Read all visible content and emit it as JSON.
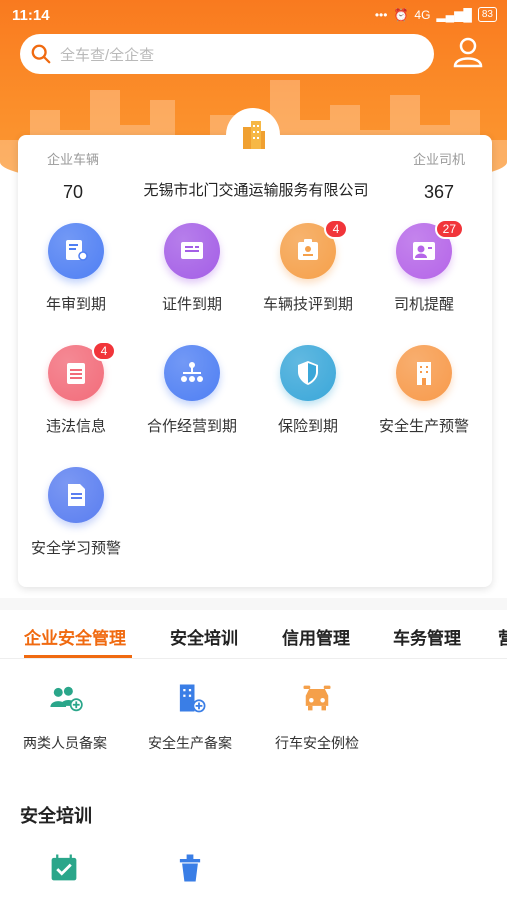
{
  "status_bar": {
    "time": "11:14",
    "network": "4G",
    "battery": "83"
  },
  "search": {
    "placeholder": "全车查/全企查"
  },
  "summary": {
    "vehicles_label": "企业车辆",
    "vehicles_count": "70",
    "drivers_label": "企业司机",
    "drivers_count": "367",
    "company_name": "无锡市北门交通运输服务有限公司"
  },
  "grid": [
    {
      "label": "年审到期",
      "icon": "document-user-icon",
      "color": "#4f7ff3",
      "badge": ""
    },
    {
      "label": "证件到期",
      "icon": "certificate-icon",
      "color": "#a45ee6",
      "badge": ""
    },
    {
      "label": "车辆技评到期",
      "icon": "id-card-icon",
      "color": "#f5a04a",
      "badge": "4"
    },
    {
      "label": "司机提醒",
      "icon": "driver-icon",
      "color": "#b565e8",
      "badge": "27"
    },
    {
      "label": "违法信息",
      "icon": "notepad-icon",
      "color": "#f26c7a",
      "badge": "4"
    },
    {
      "label": "合作经营到期",
      "icon": "org-chart-icon",
      "color": "#4f7ff3",
      "badge": ""
    },
    {
      "label": "保险到期",
      "icon": "shield-icon",
      "color": "#3aa7d9",
      "badge": ""
    },
    {
      "label": "安全生产预警",
      "icon": "building-icon",
      "color": "#f79a4b",
      "badge": ""
    },
    {
      "label": "安全学习预警",
      "icon": "file-icon",
      "color": "#5a7ef0",
      "badge": ""
    }
  ],
  "tabs": [
    {
      "label": "企业安全管理",
      "active": true
    },
    {
      "label": "安全培训",
      "active": false
    },
    {
      "label": "信用管理",
      "active": false
    },
    {
      "label": "车务管理",
      "active": false
    },
    {
      "label": "营",
      "active": false
    }
  ],
  "sub_items": [
    {
      "label": "两类人员备案",
      "icon": "users-add-icon",
      "color": "#2aa68a"
    },
    {
      "label": "安全生产备案",
      "icon": "building-add-icon",
      "color": "#3a7ee6"
    },
    {
      "label": "行车安全例检",
      "icon": "car-repair-icon",
      "color": "#f5a04a"
    }
  ],
  "section2": {
    "title": "安全培训",
    "items": [
      {
        "icon": "calendar-check-icon",
        "color": "#2aa68a"
      },
      {
        "icon": "trash-icon",
        "color": "#3a7ee6"
      }
    ]
  }
}
